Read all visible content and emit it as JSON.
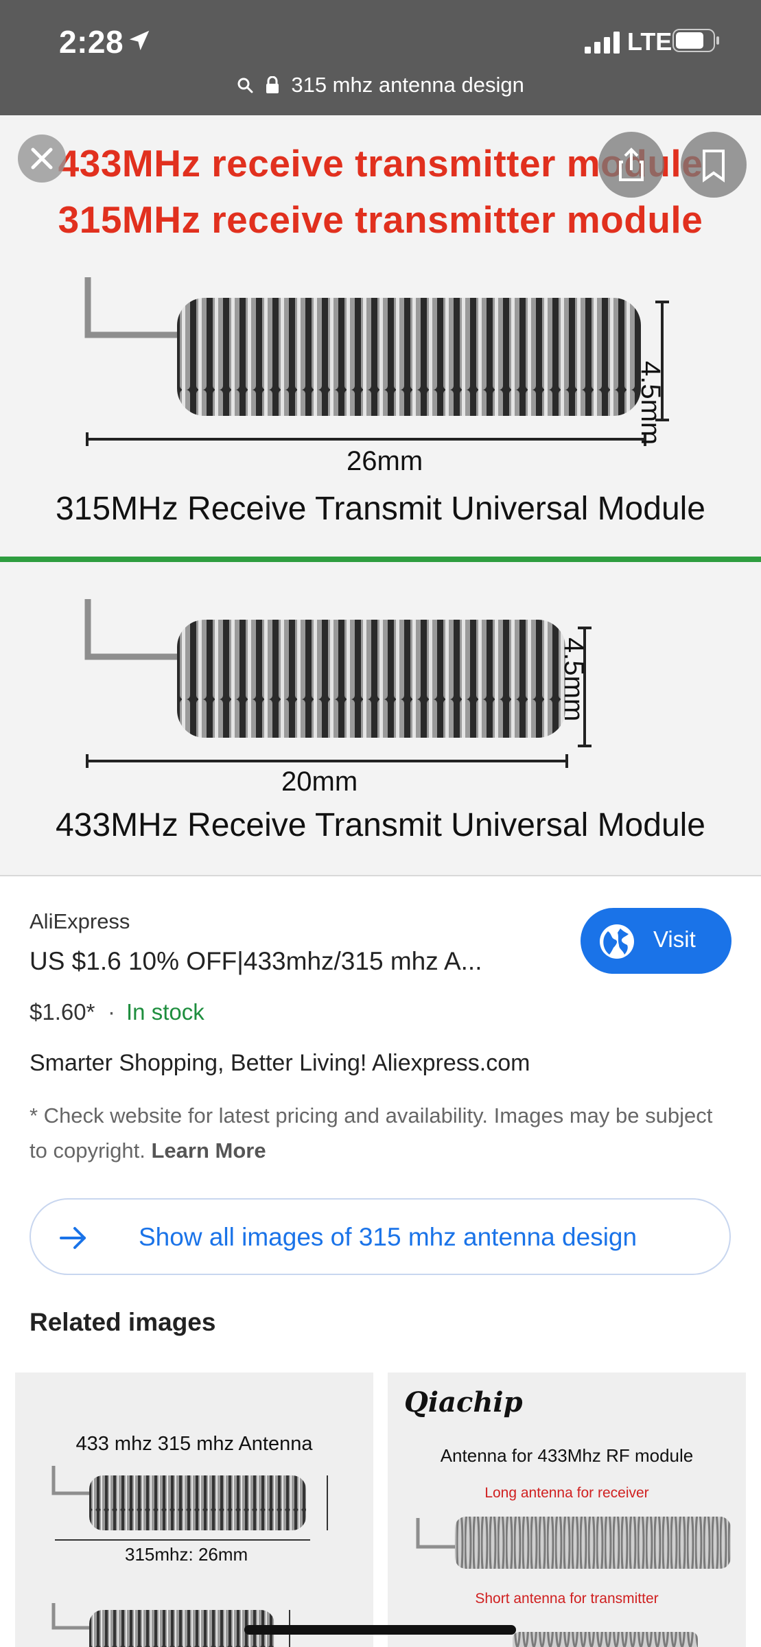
{
  "status_bar": {
    "time": "2:28",
    "network": "LTE"
  },
  "address_bar": {
    "query": "315 mhz antenna design"
  },
  "preview": {
    "panel_top": {
      "line1": "433MHz receive transmitter module",
      "line2": "315MHz receive transmitter module",
      "height_label": "4.5mm",
      "length_label": "26mm",
      "caption": "315MHz Receive Transmit Universal Module"
    },
    "panel_bottom": {
      "height_label": "4.5mm",
      "length_label": "20mm",
      "caption": "433MHz Receive Transmit Universal Module"
    }
  },
  "result": {
    "source": "AliExpress",
    "title": "US $1.6 10% OFF|433mhz/315 mhz A...",
    "price": "$1.60*",
    "separator": "·",
    "availability": "In stock",
    "tagline": "Smarter Shopping, Better Living! Aliexpress.com",
    "disclaimer": "* Check website for latest pricing and availability. Images may be subject to copyright.",
    "learn_more": "Learn More",
    "visit_label": "Visit"
  },
  "show_all": {
    "label": "Show all images of 315 mhz antenna design"
  },
  "related": {
    "heading": "Related images",
    "thumb1": {
      "title": "433 mhz 315 mhz Antenna",
      "caption": "315mhz: 26mm"
    },
    "thumb2": {
      "brand": "Qiachip",
      "title": "Antenna for 433Mhz RF module",
      "line1": "Long antenna for receiver",
      "line2": "Short antenna for transmitter"
    }
  },
  "colors": {
    "status_bg": "#5b5b5b",
    "accent_blue": "#1a73e8",
    "stock_green": "#1e8e3e",
    "title_red": "#e1301e",
    "divider_green": "#2e9d3f"
  },
  "icons": [
    "location-arrow-icon",
    "signal-icon",
    "battery-icon",
    "search-icon",
    "lock-icon",
    "close-icon",
    "share-icon",
    "bookmark-icon",
    "globe-icon",
    "arrow-right-icon"
  ]
}
